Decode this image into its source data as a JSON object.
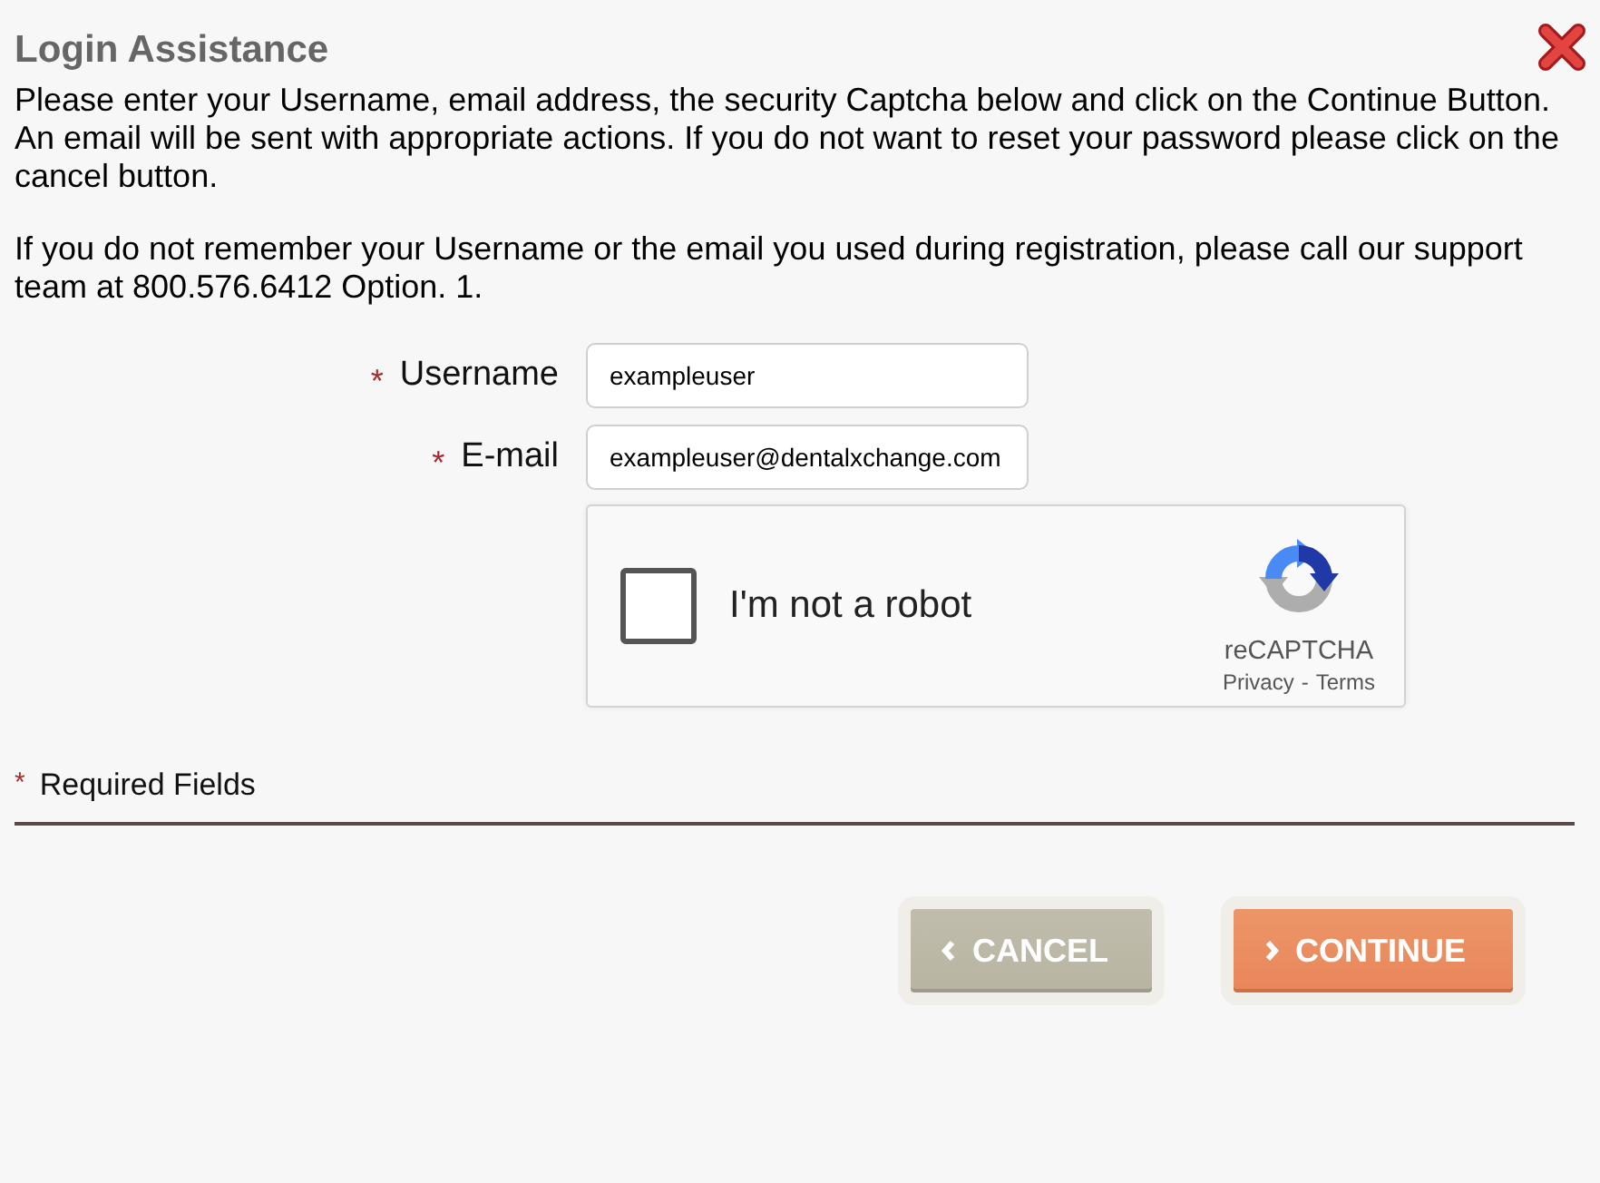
{
  "dialog": {
    "title": "Login Assistance",
    "paragraphs": [
      "Please enter your Username, email address, the security Captcha below and click on the Continue Button. An email will be sent with appropriate actions. If you do not want to reset your password please click on the cancel button.",
      "If you do not remember your Username or the email you used during registration, please call our support team at 800.576.6412 Option. 1."
    ]
  },
  "fields": [
    {
      "required_mark": "*",
      "label": "Username",
      "value": "exampleuser"
    },
    {
      "required_mark": "*",
      "label": "E-mail",
      "value": "exampleuser@dentalxchange.com"
    }
  ],
  "captcha": {
    "checked": false,
    "label": "I'm not a robot",
    "brand": "reCAPTCHA",
    "links": [
      "Privacy",
      "Terms"
    ],
    "separator": "-"
  },
  "legend": {
    "mark": "*",
    "text": "Required Fields"
  },
  "buttons": [
    {
      "kind": "cancel",
      "label": "CANCEL"
    },
    {
      "kind": "continue",
      "label": "CONTINUE"
    }
  ]
}
